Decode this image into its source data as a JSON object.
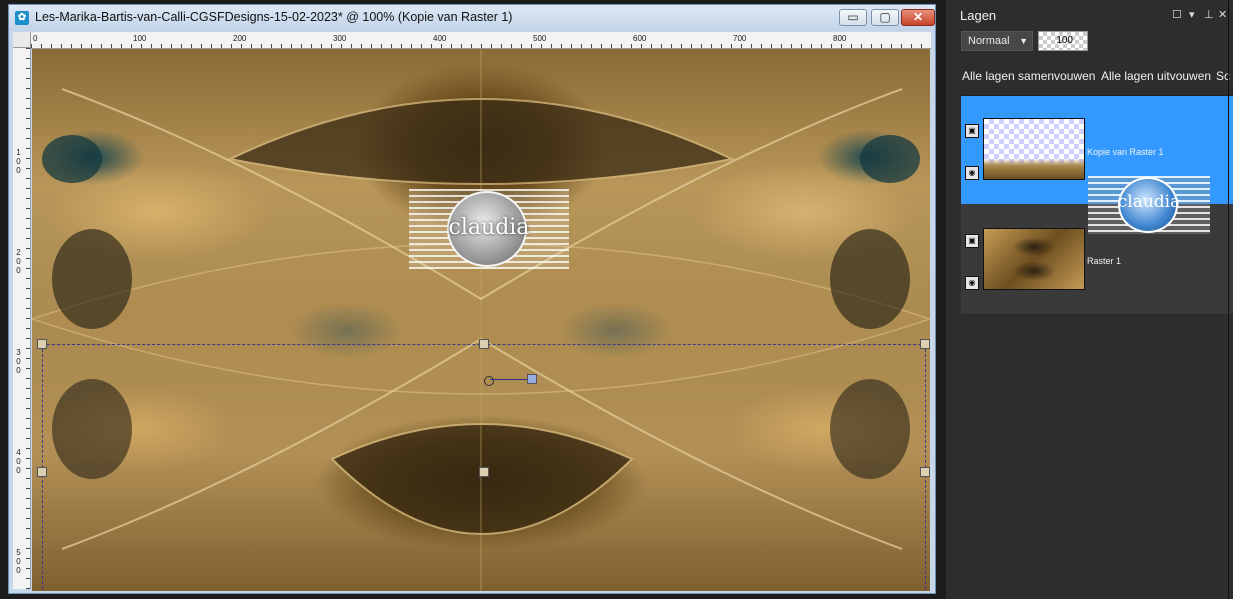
{
  "document_window": {
    "title": "Les-Marika-Bartis-van-Calli-CGSFDesigns-15-02-2023* @ 100% (Kopie van Raster 1)",
    "app_icon": "psp-icon",
    "buttons": {
      "minimize": "▭",
      "maximize": "▢",
      "close": "✕"
    },
    "ruler_top_labels": [
      "0",
      "100",
      "200",
      "300",
      "400",
      "500",
      "600",
      "700",
      "800"
    ],
    "ruler_left_labels": [
      "1\n0\n0",
      "2\n0\n0",
      "3\n0\n0",
      "4\n0\n0",
      "5\n0\n0"
    ],
    "watermark_text": "claudia"
  },
  "layers_panel": {
    "title": "Lagen",
    "blend_mode": "Normaal",
    "opacity": "100",
    "collapse_all": "Alle lagen samenvouwen",
    "expand_all": "Alle lagen uitvouwen",
    "cut_off_link": "Sc",
    "layers": [
      {
        "name": "Kopie van Raster 1",
        "selected": true
      },
      {
        "name": "Raster 1",
        "selected": false
      }
    ],
    "drag_preview_text": "claudia"
  },
  "colors": {
    "selection_highlight": "#3399ff",
    "panel_background": "#2d2d2d",
    "titlebar": "#c7d7ea"
  }
}
